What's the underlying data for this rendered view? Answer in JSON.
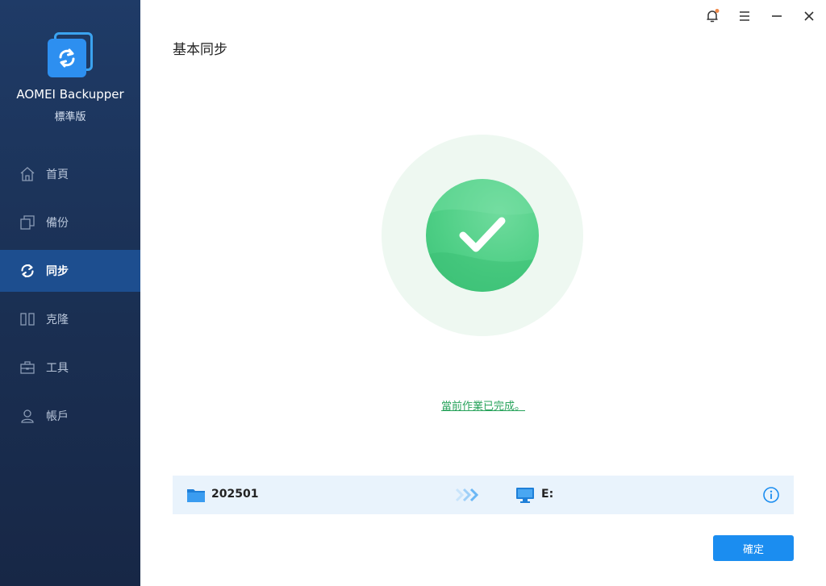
{
  "app": {
    "name": "AOMEI Backupper",
    "edition": "標準版"
  },
  "nav": {
    "items": [
      {
        "label": "首頁",
        "icon": "home-icon",
        "active": false
      },
      {
        "label": "備份",
        "icon": "backup-icon",
        "active": false
      },
      {
        "label": "同步",
        "icon": "sync-icon",
        "active": true
      },
      {
        "label": "克隆",
        "icon": "clone-icon",
        "active": false
      },
      {
        "label": "工具",
        "icon": "tools-icon",
        "active": false
      },
      {
        "label": "帳戶",
        "icon": "account-icon",
        "active": false
      }
    ]
  },
  "titlebar": {
    "notification_icon": "bell-icon",
    "menu_icon": "menu-icon",
    "minimize_icon": "minimize-icon",
    "close_icon": "close-icon",
    "notification_dot_color": "#f08a4b"
  },
  "page": {
    "title": "基本同步",
    "status_text": "當前作業已完成。"
  },
  "task": {
    "source": "202501",
    "destination": "E:",
    "source_icon": "folder-icon",
    "destination_icon": "computer-icon",
    "arrows_icon": "arrows-right-icon",
    "info_icon": "info-icon"
  },
  "actions": {
    "confirm_label": "確定"
  },
  "colors": {
    "sidebar_bg": "#1f3b67",
    "active_nav_bg": "#1d4e8f",
    "success_green": "#4fcf86",
    "accent_blue": "#1b8df0"
  }
}
